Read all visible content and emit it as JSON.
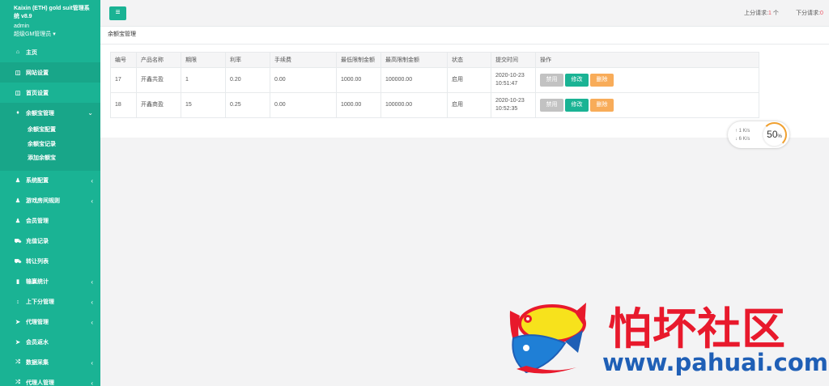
{
  "brand": {
    "title": "Kaixin (ETH) gold suit管理系统 v8.9",
    "user": "admin",
    "role": "超级GM管理员 ▾"
  },
  "sidebar": {
    "items": [
      {
        "icon": "home-icon",
        "glyph": "⌂",
        "label": "主页"
      },
      {
        "icon": "window-icon",
        "glyph": "◫",
        "label": "网站设置"
      },
      {
        "icon": "window-icon",
        "glyph": "◫",
        "label": "首页设置"
      },
      {
        "icon": "bank-icon",
        "glyph": "♦",
        "label": "余额宝管理",
        "expanded": true
      },
      {
        "icon": "user-icon",
        "glyph": "♟",
        "label": "系统配置",
        "chevron": "‹"
      },
      {
        "icon": "user-icon",
        "glyph": "♟",
        "label": "游戏房间规则",
        "chevron": "‹"
      },
      {
        "icon": "users-icon",
        "glyph": "♟",
        "label": "会员管理"
      },
      {
        "icon": "car-icon",
        "glyph": "⛟",
        "label": "充值记录"
      },
      {
        "icon": "car-icon",
        "glyph": "⛟",
        "label": "转让列表"
      },
      {
        "icon": "bar-chart-icon",
        "glyph": "▮",
        "label": "输赢统计",
        "chevron": "‹"
      },
      {
        "icon": "updown-icon",
        "glyph": "↕",
        "label": "上下分管理",
        "chevron": "‹"
      },
      {
        "icon": "send-icon",
        "glyph": "➤",
        "label": "代理管理",
        "chevron": "‹"
      },
      {
        "icon": "send-icon",
        "glyph": "➤",
        "label": "会员返水"
      },
      {
        "icon": "shuffle-icon",
        "glyph": "⤮",
        "label": "数据采集",
        "chevron": "‹"
      },
      {
        "icon": "shuffle-icon",
        "glyph": "⤮",
        "label": "代理人管理",
        "chevron": "‹"
      }
    ],
    "subitems": [
      "余额宝配置",
      "余额宝记录",
      "添加余额宝"
    ]
  },
  "topbar": {
    "menu_glyph": "≡",
    "up_label": "上分请求:",
    "up_count": "1",
    "up_unit": "个",
    "down_label": "下分请求:",
    "down_count": "0"
  },
  "panel": {
    "title": "余额宝管理"
  },
  "table": {
    "headers": [
      "编号",
      "产品名称",
      "期限",
      "利率",
      "手续费",
      "最低限制金额",
      "最高限制金额",
      "状态",
      "提交时间",
      "操作"
    ],
    "rows": [
      {
        "id": "17",
        "name": "开鑫共盈",
        "term": "1",
        "rate": "0.20",
        "fee": "0.00",
        "min": "1000.00",
        "max": "100000.00",
        "status": "启用",
        "date": "2020-10-23",
        "time": "10:51:47"
      },
      {
        "id": "18",
        "name": "开鑫商盈",
        "term": "15",
        "rate": "0.25",
        "fee": "0.00",
        "min": "1000.00",
        "max": "100000.00",
        "status": "启用",
        "date": "2020-10-23",
        "time": "10:52:35"
      }
    ],
    "actions": {
      "disable": "禁用",
      "edit": "修改",
      "delete": "删除"
    }
  },
  "speed_widget": {
    "up": "↑ 1  K/s",
    "down": "↓ 6  K/s",
    "percent": "50",
    "percent_unit": "%"
  },
  "watermark": {
    "cn": "怕坏社区",
    "url": "www.pahuai.com"
  },
  "colors": {
    "accent": "#1ab394",
    "warning": "#f8ac59",
    "disabled": "#c2c2c2",
    "watermark_red": "#e8192c",
    "watermark_blue": "#1f5fb6"
  }
}
